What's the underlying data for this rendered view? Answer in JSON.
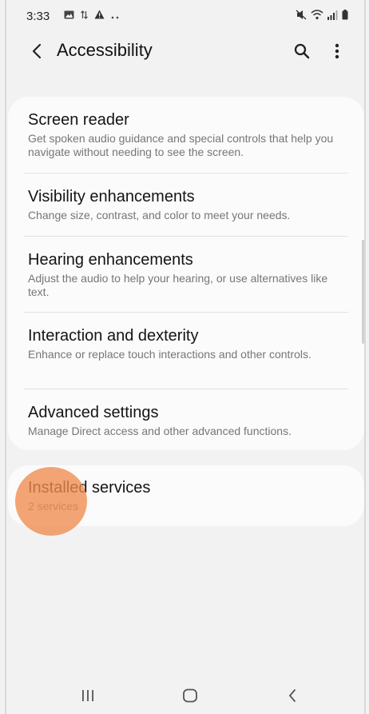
{
  "status_bar": {
    "time": "3:33",
    "left_icons": [
      "image-icon",
      "data-transfer-icon",
      "warning-icon",
      "more-dots-icon"
    ],
    "right_icons": [
      "mute-icon",
      "wifi-icon",
      "signal-icon",
      "battery-icon"
    ]
  },
  "app_bar": {
    "title": "Accessibility",
    "back_icon": "back-chevron-icon",
    "search_icon": "search-icon",
    "more_icon": "more-vert-icon"
  },
  "items": [
    {
      "title": "Screen reader",
      "subtitle": "Get spoken audio guidance and special controls that help you navigate without needing to see the screen."
    },
    {
      "title": "Visibility enhancements",
      "subtitle": "Change size, contrast, and color to meet your needs."
    },
    {
      "title": "Hearing enhancements",
      "subtitle": "Adjust the audio to help your hearing, or use alternatives like text."
    },
    {
      "title": "Interaction and dexterity",
      "subtitle": "Enhance or replace touch interactions and other controls."
    },
    {
      "title": "Advanced settings",
      "subtitle": "Manage Direct access and other advanced functions."
    }
  ],
  "installed": {
    "title": "Installed services",
    "subtitle": "2 services"
  },
  "nav_bar": {
    "icons": [
      "recent-apps-icon",
      "home-icon",
      "back-icon"
    ]
  },
  "colors": {
    "background": "#f2f2f2",
    "card": "#fbfbfb",
    "touch_indicator": "#f08c50",
    "secondary_text": "#767676"
  }
}
